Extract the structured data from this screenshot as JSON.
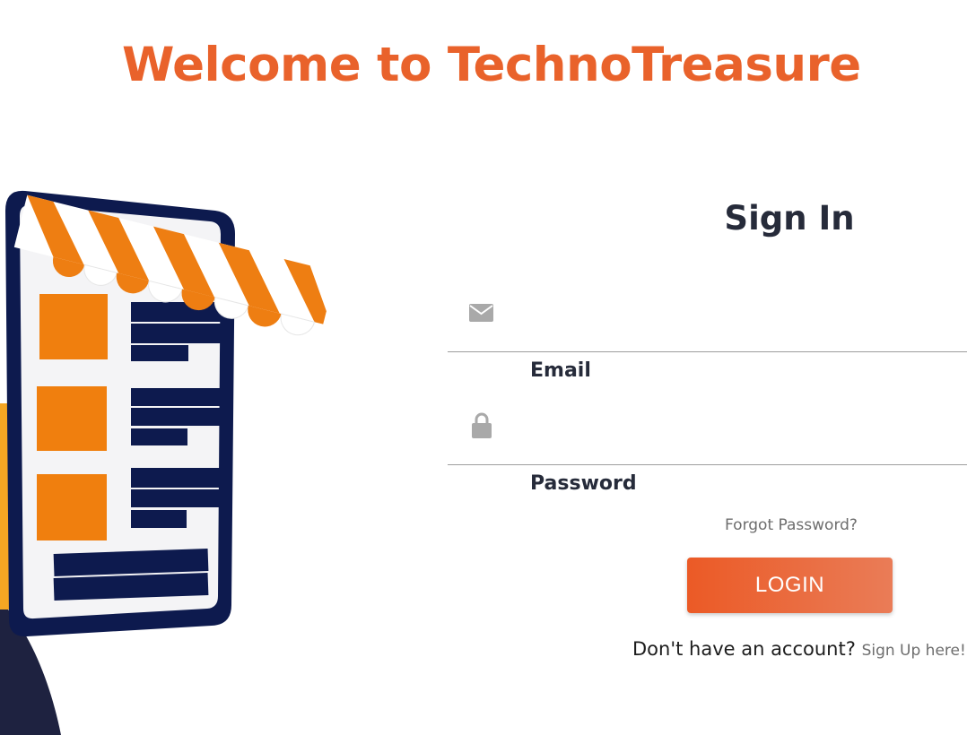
{
  "header": {
    "title": "Welcome to TechnoTreasure"
  },
  "illustration": {
    "name": "online-store-illustration"
  },
  "form": {
    "title": "Sign In",
    "email": {
      "label": "Email",
      "value": "",
      "icon": "envelope-icon"
    },
    "password": {
      "label": "Password",
      "value": "",
      "icon": "lock-icon"
    },
    "forgot_label": "Forgot Password?",
    "login_label": "LOGIN",
    "signup_prompt": "Don't have an account?",
    "signup_link": "Sign Up here!"
  },
  "colors": {
    "accent": "#e9622b",
    "button_start": "#eb5a26",
    "button_end": "#ea7c57",
    "text_dark": "#262b3a",
    "illustration_navy": "#0d1a4e",
    "illustration_orange": "#f07f0e"
  }
}
